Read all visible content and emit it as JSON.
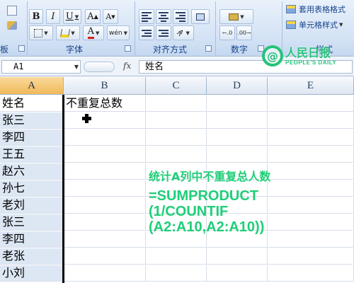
{
  "ribbon": {
    "groups": {
      "font": "字体",
      "alignment": "对齐方式",
      "number": "数字",
      "styles": "样式",
      "partial_left": "板"
    },
    "font_buttons": {
      "bold": "B",
      "italic": "I",
      "underline": "U",
      "grow_font": "A",
      "shrink_font": "A",
      "phonetic": "wén",
      "font_color": "A"
    },
    "styles": {
      "format_as_table": "套用表格格式",
      "cell_styles": "单元格样式"
    }
  },
  "formula_bar": {
    "name_box": "A1",
    "fx": "fx",
    "content": "姓名"
  },
  "grid": {
    "columns": [
      "A",
      "B",
      "C",
      "D",
      "E"
    ],
    "selected_column": "A",
    "rows": [
      {
        "a": "姓名",
        "b": "不重复总数"
      },
      {
        "a": "张三",
        "b": ""
      },
      {
        "a": "李四",
        "b": ""
      },
      {
        "a": "王五",
        "b": ""
      },
      {
        "a": "赵六",
        "b": ""
      },
      {
        "a": "孙七",
        "b": ""
      },
      {
        "a": "老刘",
        "b": ""
      },
      {
        "a": "张三",
        "b": ""
      },
      {
        "a": "李四",
        "b": ""
      },
      {
        "a": "老张",
        "b": ""
      },
      {
        "a": "小刘",
        "b": ""
      }
    ]
  },
  "watermark": {
    "cn": "人民日报",
    "en": "PEOPLE'S DAILY",
    "mark": "@"
  },
  "annotation": {
    "title": "统计A列中不重复总人数",
    "formula_lines": [
      "=SUMPRODUCT",
      "(1/COUNTIF",
      "(A2:A10,A2:A10))"
    ]
  },
  "colors": {
    "annotation_green": "#1fce78",
    "logo_green": "#27c27a",
    "column_fill": "#dde7f4",
    "header_selected": "#f0b95a"
  }
}
